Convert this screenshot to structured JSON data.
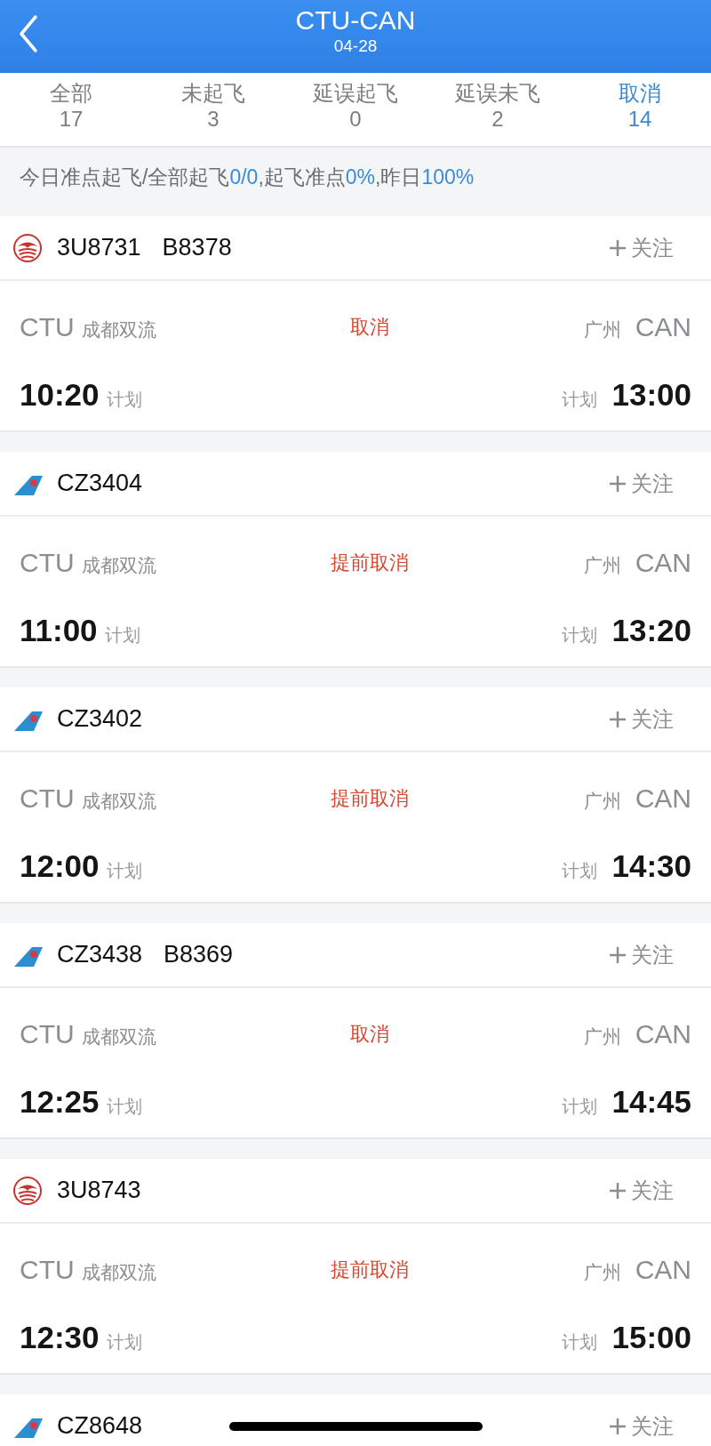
{
  "header": {
    "title": "CTU-CAN",
    "date": "04-28"
  },
  "tabs": [
    {
      "label": "全部",
      "count": "17",
      "selected": false
    },
    {
      "label": "未起飞",
      "count": "3",
      "selected": false
    },
    {
      "label": "延误起飞",
      "count": "0",
      "selected": false
    },
    {
      "label": "延误未飞",
      "count": "2",
      "selected": false
    },
    {
      "label": "取消",
      "count": "14",
      "selected": true
    }
  ],
  "stats": [
    {
      "text": "今日准点起飞/全部起飞",
      "highlight": false
    },
    {
      "text": "0/0",
      "highlight": true
    },
    {
      "text": ",起飞准点",
      "highlight": false
    },
    {
      "text": "0%",
      "highlight": true
    },
    {
      "text": ",昨日",
      "highlight": false
    },
    {
      "text": "100%",
      "highlight": true
    }
  ],
  "flights": [
    {
      "kind": "sichuan",
      "number": "3U8731",
      "registration": "B8378",
      "follow": "关注",
      "status": "取消",
      "dep_code": "CTU",
      "dep_name": "成都双流",
      "arr_name": "广州",
      "arr_code": "CAN",
      "dep_time": "10:20",
      "dep_note": "计划",
      "arr_note": "计划",
      "arr_time": "13:00"
    },
    {
      "kind": "southern",
      "number": "CZ3404",
      "follow": "关注",
      "status": "提前取消",
      "dep_code": "CTU",
      "dep_name": "成都双流",
      "arr_name": "广州",
      "arr_code": "CAN",
      "dep_time": "11:00",
      "dep_note": "计划",
      "arr_note": "计划",
      "arr_time": "13:20"
    },
    {
      "kind": "southern",
      "number": "CZ3402",
      "follow": "关注",
      "status": "提前取消",
      "dep_code": "CTU",
      "dep_name": "成都双流",
      "arr_name": "广州",
      "arr_code": "CAN",
      "dep_time": "12:00",
      "dep_note": "计划",
      "arr_note": "计划",
      "arr_time": "14:30"
    },
    {
      "kind": "southern",
      "number": "CZ3438",
      "registration": "B8369",
      "follow": "关注",
      "status": "取消",
      "dep_code": "CTU",
      "dep_name": "成都双流",
      "arr_name": "广州",
      "arr_code": "CAN",
      "dep_time": "12:25",
      "dep_note": "计划",
      "arr_note": "计划",
      "arr_time": "14:45"
    },
    {
      "kind": "sichuan",
      "number": "3U8743",
      "follow": "关注",
      "status": "提前取消",
      "dep_code": "CTU",
      "dep_name": "成都双流",
      "arr_name": "广州",
      "arr_code": "CAN",
      "dep_time": "12:30",
      "dep_note": "计划",
      "arr_note": "计划",
      "arr_time": "15:00"
    },
    {
      "kind": "southern",
      "number": "CZ8648",
      "follow": "关注"
    }
  ]
}
